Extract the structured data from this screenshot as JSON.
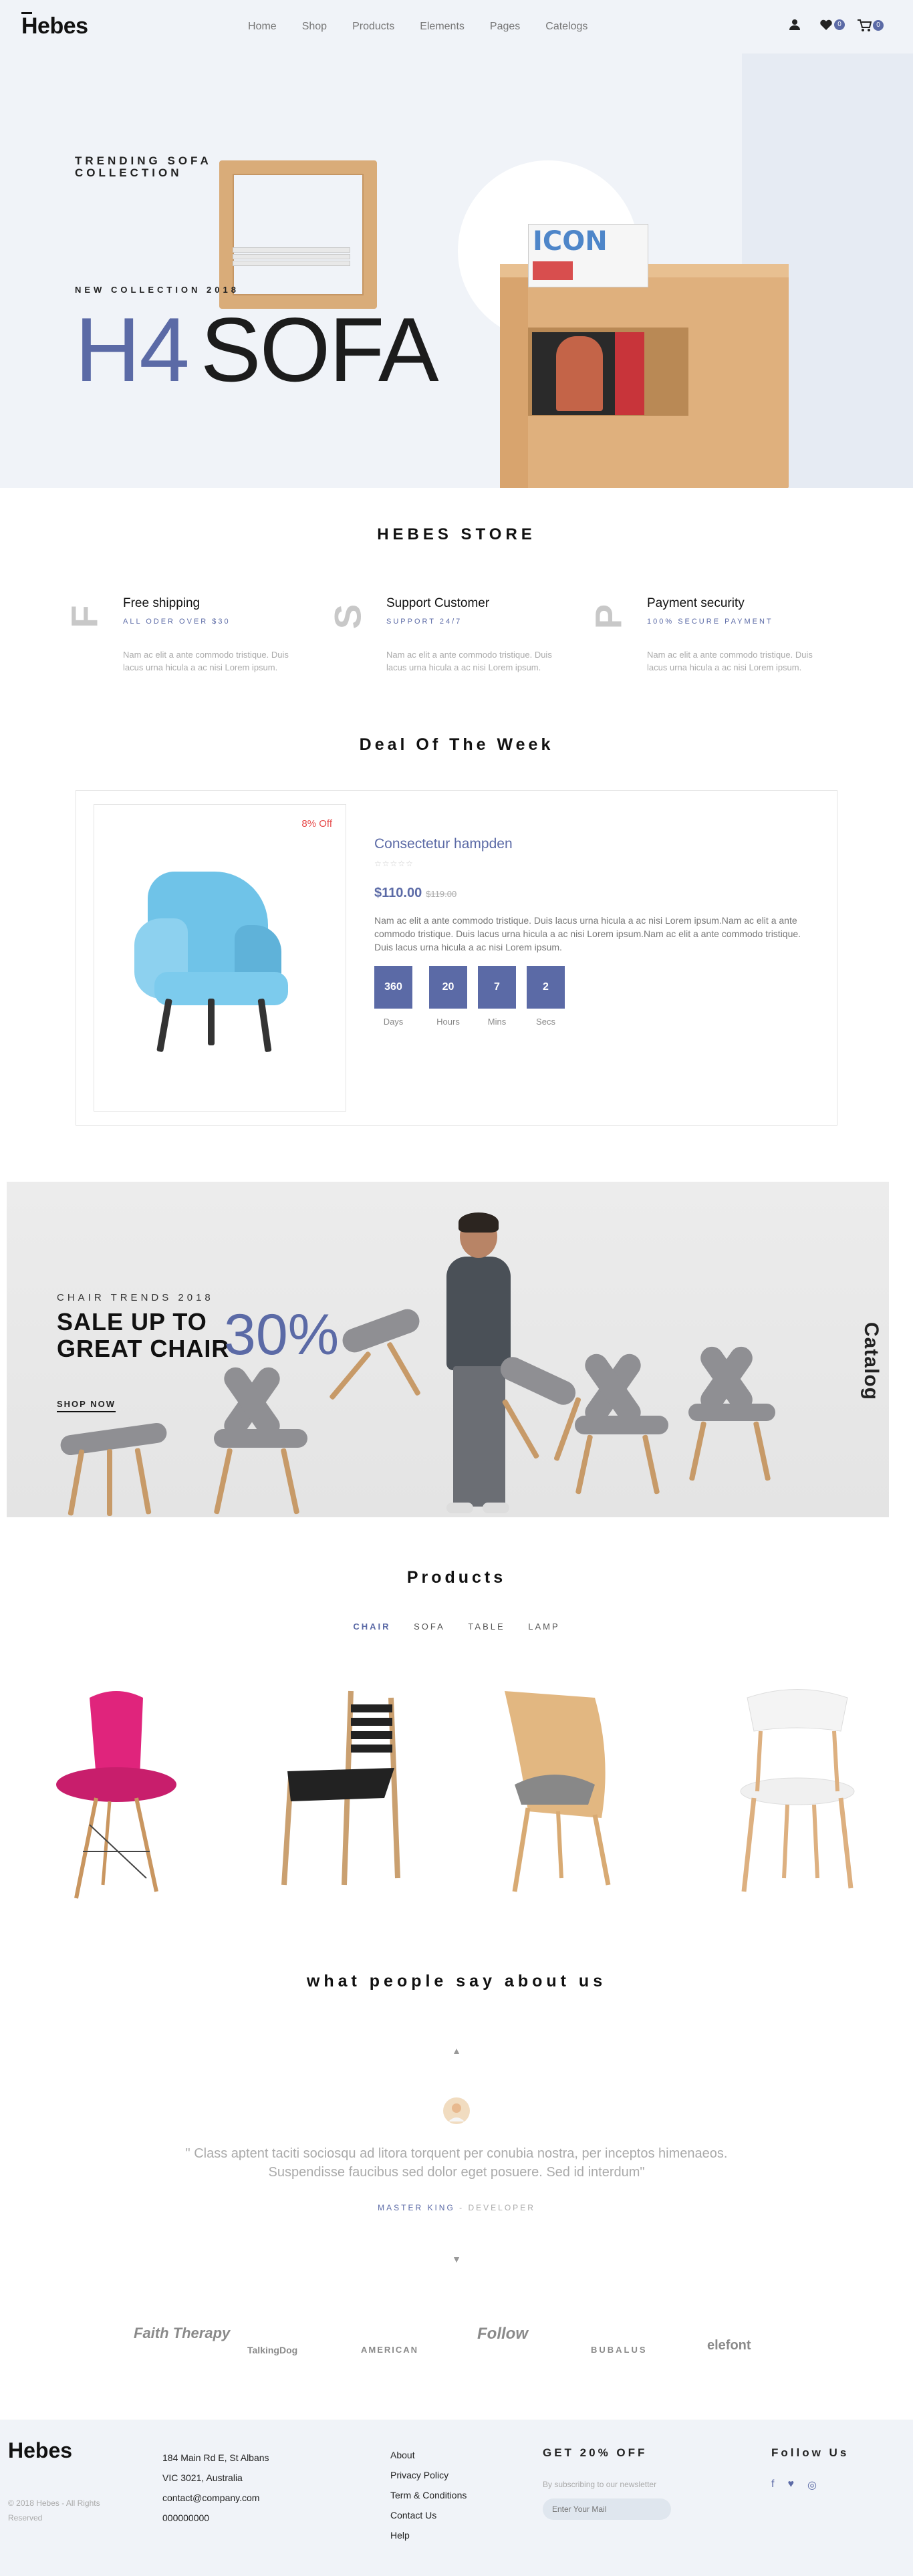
{
  "header": {
    "logo": "Hebes",
    "nav": [
      "Home",
      "Shop",
      "Products",
      "Elements",
      "Pages",
      "Catelogs"
    ],
    "wishlist_count": "0",
    "cart_count": "0"
  },
  "hero": {
    "eyebrow": "TRENDING SOFA COLLECTION",
    "sub": "NEW COLLECTION 2018",
    "title_accent": "H4",
    "title_main": "SOFA",
    "magazine_title": "ICON"
  },
  "store": {
    "title": "HEBES STORE",
    "features": [
      {
        "letter": "F",
        "title": "Free shipping",
        "sub": "ALL ODER OVER $30",
        "desc": "Nam ac elit a ante commodo tristique. Duis lacus urna hicula a ac nisi Lorem ipsum."
      },
      {
        "letter": "S",
        "title": "Support Customer",
        "sub": "SUPPORT 24/7",
        "desc": "Nam ac elit a ante commodo tristique. Duis lacus urna hicula a ac nisi Lorem ipsum."
      },
      {
        "letter": "P",
        "title": "Payment security",
        "sub": "100% SECURE PAYMENT",
        "desc": "Nam ac elit a ante commodo tristique. Duis lacus urna hicula a ac nisi Lorem ipsum."
      }
    ]
  },
  "deal": {
    "title": "Deal Of The Week",
    "badge": "8% Off",
    "product_name": "Consectetur hampden",
    "stars": "☆☆☆☆☆",
    "price": "$110.00",
    "old_price": "$119.00",
    "description": "Nam ac elit a ante commodo tristique. Duis lacus urna hicula a ac nisi Lorem ipsum.Nam ac elit a ante commodo tristique. Duis lacus urna hicula a ac nisi Lorem ipsum.Nam ac elit a ante commodo tristique. Duis lacus urna hicula a ac nisi Lorem ipsum.",
    "countdown": [
      {
        "value": "360",
        "label": "Days"
      },
      {
        "value": "20",
        "label": "Hours"
      },
      {
        "value": "7",
        "label": "Mins"
      },
      {
        "value": "2",
        "label": "Secs"
      }
    ]
  },
  "banner": {
    "eyebrow": "CHAIR TRENDS 2018",
    "line1": "SALE UP TO",
    "line2": "GREAT CHAIR",
    "percent": "30%",
    "cta": "SHOP NOW",
    "side_label": "Catalog"
  },
  "products": {
    "title": "Products",
    "tabs": [
      "CHAIR",
      "SOFA",
      "TABLE",
      "LAMP"
    ],
    "active_tab": "CHAIR"
  },
  "testimonials": {
    "title": "what people say about us",
    "quote_line1": "\" Class aptent taciti sociosqu ad litora torquent per conubia nostra, per inceptos himenaeos.",
    "quote_line2": "Suspendisse faucibus sed dolor eget posuere. Sed id interdum\"",
    "author": "MASTER KING",
    "role": "DEVELOPER"
  },
  "brands": [
    "Faith Therapy",
    "TalkingDog",
    "AMERICAN",
    "Follow",
    "BUBALUS",
    "elefont"
  ],
  "footer": {
    "logo": "Hebes",
    "copyright": "© 2018 Hebes - All Rights Reserved",
    "address": [
      "184 Main Rd E, St Albans",
      "VIC 3021, Australia",
      "contact@company.com",
      "000000000"
    ],
    "links": [
      "About",
      "Privacy Policy",
      "Term & Conditions",
      "Contact Us",
      "Help"
    ],
    "news_title": "GET 20% OFF",
    "news_sub": "By subscribing to our newsletter",
    "news_placeholder": "Enter Your Mail",
    "follow_title": "Follow Us"
  }
}
